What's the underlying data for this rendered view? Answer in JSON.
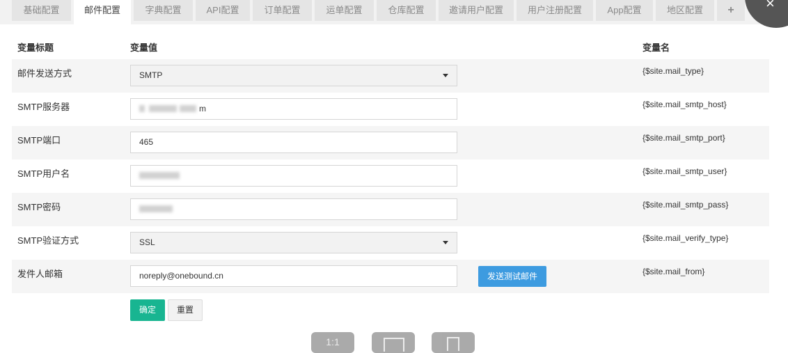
{
  "tabs": [
    {
      "label": "基础配置",
      "active": false
    },
    {
      "label": "邮件配置",
      "active": true
    },
    {
      "label": "字典配置",
      "active": false
    },
    {
      "label": "API配置",
      "active": false
    },
    {
      "label": "订单配置",
      "active": false
    },
    {
      "label": "运单配置",
      "active": false
    },
    {
      "label": "仓库配置",
      "active": false
    },
    {
      "label": "邀请用户配置",
      "active": false
    },
    {
      "label": "用户注册配置",
      "active": false
    },
    {
      "label": "App配置",
      "active": false
    },
    {
      "label": "地区配置",
      "active": false
    },
    {
      "label": "+",
      "active": false
    }
  ],
  "close_glyph": "×",
  "table": {
    "headers": {
      "title": "变量标题",
      "value": "变量值",
      "name": "变量名"
    },
    "rows": [
      {
        "label": "邮件发送方式",
        "type": "select",
        "value": "SMTP",
        "var": "{$site.mail_type}"
      },
      {
        "label": "SMTP服务器",
        "type": "input",
        "value": "m",
        "var": "{$site.mail_smtp_host}"
      },
      {
        "label": "SMTP端口",
        "type": "input",
        "value": "465",
        "var": "{$site.mail_smtp_port}"
      },
      {
        "label": "SMTP用户名",
        "type": "input",
        "value": "",
        "var": "{$site.mail_smtp_user}"
      },
      {
        "label": "SMTP密码",
        "type": "input",
        "value": "",
        "var": "{$site.mail_smtp_pass}"
      },
      {
        "label": "SMTP验证方式",
        "type": "select",
        "value": "SSL",
        "var": "{$site.mail_verify_type}"
      },
      {
        "label": "发件人邮箱",
        "type": "input",
        "value": "noreply@onebound.cn",
        "var": "{$site.mail_from}"
      }
    ]
  },
  "buttons": {
    "send_test": "发送测试邮件",
    "confirm": "确定",
    "reset": "重置"
  },
  "viewer": {
    "one_to_one": "1:1"
  },
  "icons": {
    "caret": "caret-down-icon",
    "close": "close-icon",
    "fullscreen": "fullscreen-icon",
    "rotate": "rotate-icon"
  },
  "colors": {
    "primary": "#18b591",
    "info": "#3d9be0"
  }
}
